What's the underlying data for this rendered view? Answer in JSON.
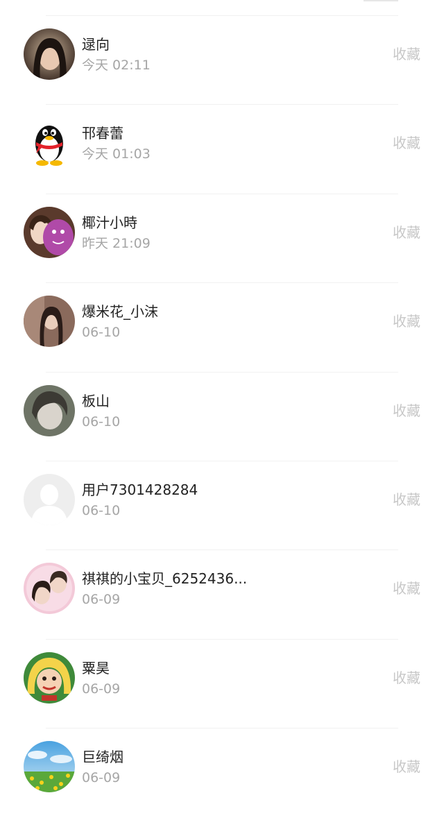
{
  "users": [
    {
      "name": "逯向",
      "time": "今天 02:11",
      "action": "收藏",
      "avatar": "avatar-photo-girl-icon"
    },
    {
      "name": "邗春蕾",
      "time": "今天 01:03",
      "action": "收藏",
      "avatar": "qq-penguin-icon"
    },
    {
      "name": "椰汁小時",
      "time": "昨天 21:09",
      "action": "收藏",
      "avatar": "avatar-photo-plush-icon"
    },
    {
      "name": "爆米花_小沫",
      "time": "06-10",
      "action": "收藏",
      "avatar": "avatar-photo-girl-icon"
    },
    {
      "name": "板山",
      "time": "06-10",
      "action": "收藏",
      "avatar": "avatar-photo-boy-icon"
    },
    {
      "name": "用户7301428284",
      "time": "06-10",
      "action": "收藏",
      "avatar": "default-user-icon"
    },
    {
      "name": "祺祺的小宝贝_6252436...",
      "time": "06-09",
      "action": "收藏",
      "avatar": "avatar-photo-pink-icon"
    },
    {
      "name": "粟昊",
      "time": "06-09",
      "action": "收藏",
      "avatar": "anime-character-icon"
    },
    {
      "name": "巨绮烟",
      "time": "06-09",
      "action": "收藏",
      "avatar": "landscape-flowers-icon"
    }
  ]
}
